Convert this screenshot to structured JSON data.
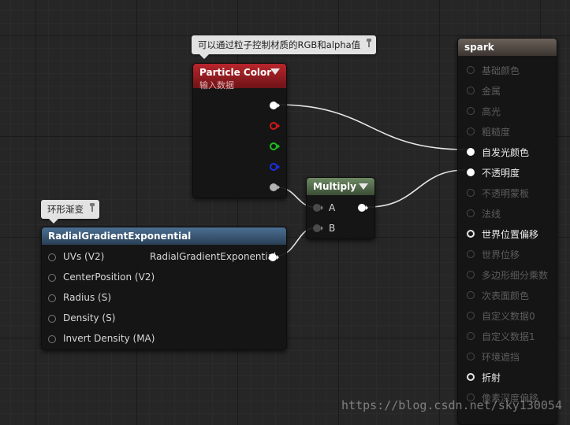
{
  "comments": {
    "particle_color_comment": "可以通过粒子控制材质的RGB和alpha值",
    "radial_gradient_comment": "环形渐变"
  },
  "particle_color_node": {
    "title": "Particle Color",
    "subtitle": "输入数据",
    "pins": [
      {
        "name": "rgba",
        "color": "#ffffff"
      },
      {
        "name": "r",
        "color": "#d01818"
      },
      {
        "name": "g",
        "color": "#1dc01d"
      },
      {
        "name": "b",
        "color": "#1a2fe0"
      },
      {
        "name": "a",
        "color": "#b4b4b4"
      }
    ]
  },
  "multiply_node": {
    "title": "Multiply",
    "input_a": "A",
    "input_b": "B"
  },
  "radial_gradient_node": {
    "title": "RadialGradientExponential",
    "output_label": "RadialGradientExponential",
    "inputs": [
      "UVs (V2)",
      "CenterPosition (V2)",
      "Radius (S)",
      "Density (S)",
      "Invert Density (MA)"
    ]
  },
  "spark_node": {
    "title": "spark",
    "inputs": [
      {
        "label": "基础颜色",
        "active": false
      },
      {
        "label": "金属",
        "active": false
      },
      {
        "label": "高光",
        "active": false
      },
      {
        "label": "粗糙度",
        "active": false
      },
      {
        "label": "自发光颜色",
        "active": true,
        "connected": true
      },
      {
        "label": "不透明度",
        "active": true,
        "connected": true
      },
      {
        "label": "不透明蒙板",
        "active": false
      },
      {
        "label": "法线",
        "active": false
      },
      {
        "label": "世界位置偏移",
        "active": true,
        "connected": false
      },
      {
        "label": "世界位移",
        "active": false
      },
      {
        "label": "多边形细分乘数",
        "active": false
      },
      {
        "label": "次表面颜色",
        "active": false
      },
      {
        "label": "自定义数据0",
        "active": false
      },
      {
        "label": "自定义数据1",
        "active": false
      },
      {
        "label": "环境遮挡",
        "active": false
      },
      {
        "label": "折射",
        "active": true,
        "connected": false
      },
      {
        "label": "像素深度偏移",
        "active": false
      }
    ]
  },
  "watermark": "https://blog.csdn.net/sky130054",
  "colors": {
    "particle_header": "#b8262c",
    "multiply_header": "#6d8a63",
    "radial_header": "#4b6f93",
    "spark_header": "#6c625a",
    "wire": "#e8e8e8"
  }
}
